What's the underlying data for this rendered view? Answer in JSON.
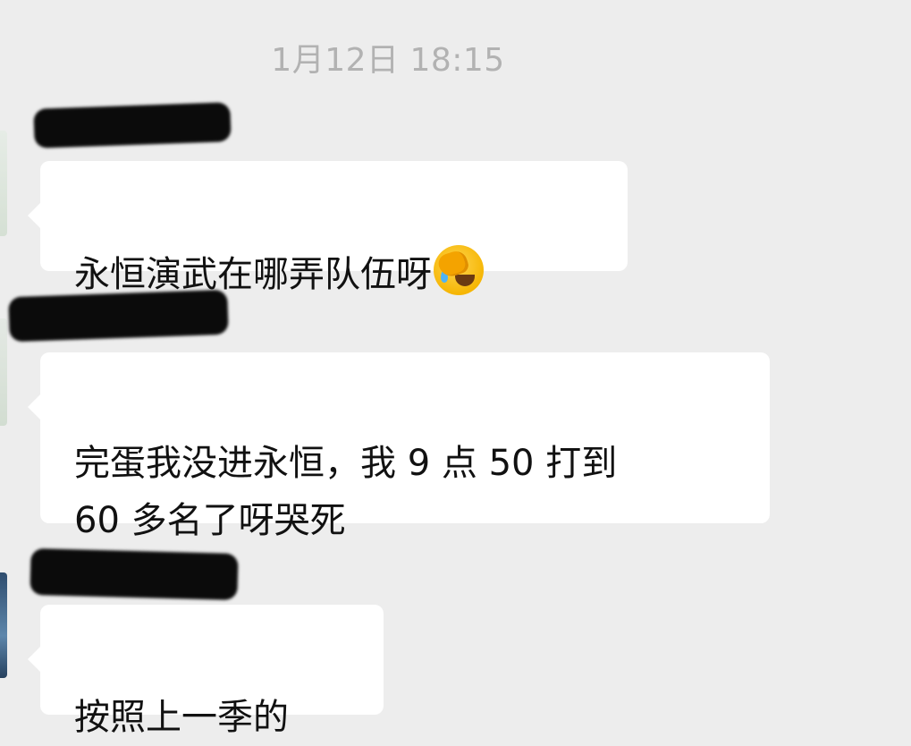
{
  "chat": {
    "timestamp": "1月12日 18:15",
    "messages": [
      {
        "text": "永恒演武在哪弄队伍呀",
        "emoji": "face-palm-crying-emoji"
      },
      {
        "text": "完蛋我没进永恒，我 9 点 50 打到\n60 多名了呀哭死"
      },
      {
        "text": "按照上一季的"
      }
    ],
    "sender_names_redacted": true
  },
  "colors": {
    "background": "#ededed",
    "bubble": "#ffffff",
    "timestamp": "#b2b2b2",
    "text": "#111111"
  }
}
